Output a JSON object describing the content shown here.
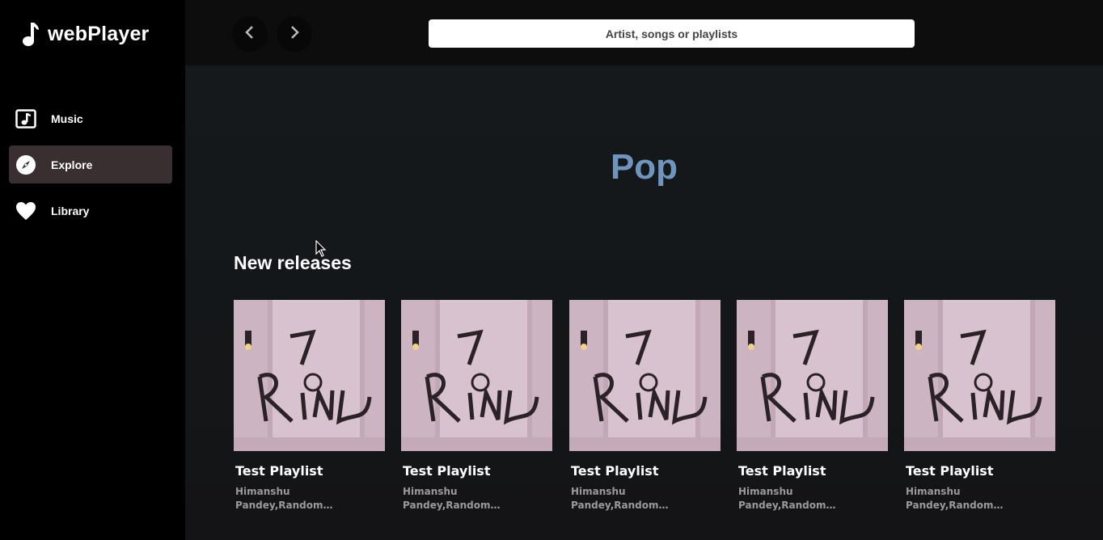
{
  "brand": {
    "title": "webPlayer",
    "icon": "music-note-icon"
  },
  "sidebar": {
    "items": [
      {
        "label": "Music",
        "icon": "music-square-icon",
        "active": false
      },
      {
        "label": "Explore",
        "icon": "compass-icon",
        "active": true
      },
      {
        "label": "Library",
        "icon": "heart-icon",
        "active": false
      }
    ]
  },
  "topbar": {
    "back_icon": "chevron-left-icon",
    "forward_icon": "chevron-right-icon",
    "search": {
      "placeholder": "Artist, songs or playlists",
      "value": ""
    }
  },
  "main": {
    "genre_title": "Pop",
    "section_title": "New releases",
    "cards": [
      {
        "title": "Test Playlist",
        "description": "Himanshu Pandey,Random Person,John Doe,Pandey Himanshu",
        "cover_text": "7 RINGS"
      },
      {
        "title": "Test Playlist",
        "description": "Himanshu Pandey,Random Person,John Doe,Pandey Himanshu",
        "cover_text": "7 RINGS"
      },
      {
        "title": "Test Playlist",
        "description": "Himanshu Pandey,Random Person,John Doe,Pandey Himanshu",
        "cover_text": "7 RINGS"
      },
      {
        "title": "Test Playlist",
        "description": "Himanshu Pandey,Random Person,John Doe,Pandey Himanshu",
        "cover_text": "7 RINGS"
      },
      {
        "title": "Test Playlist",
        "description": "Himanshu Pandey,Random Person,John Doe,Pandey Himanshu",
        "cover_text": "7 RINGS"
      }
    ]
  },
  "colors": {
    "sidebar_bg": "#000000",
    "active_item_bg": "#3a2f30",
    "genre_title": "#6f95be",
    "cover_bg": "#cfb6c4"
  }
}
